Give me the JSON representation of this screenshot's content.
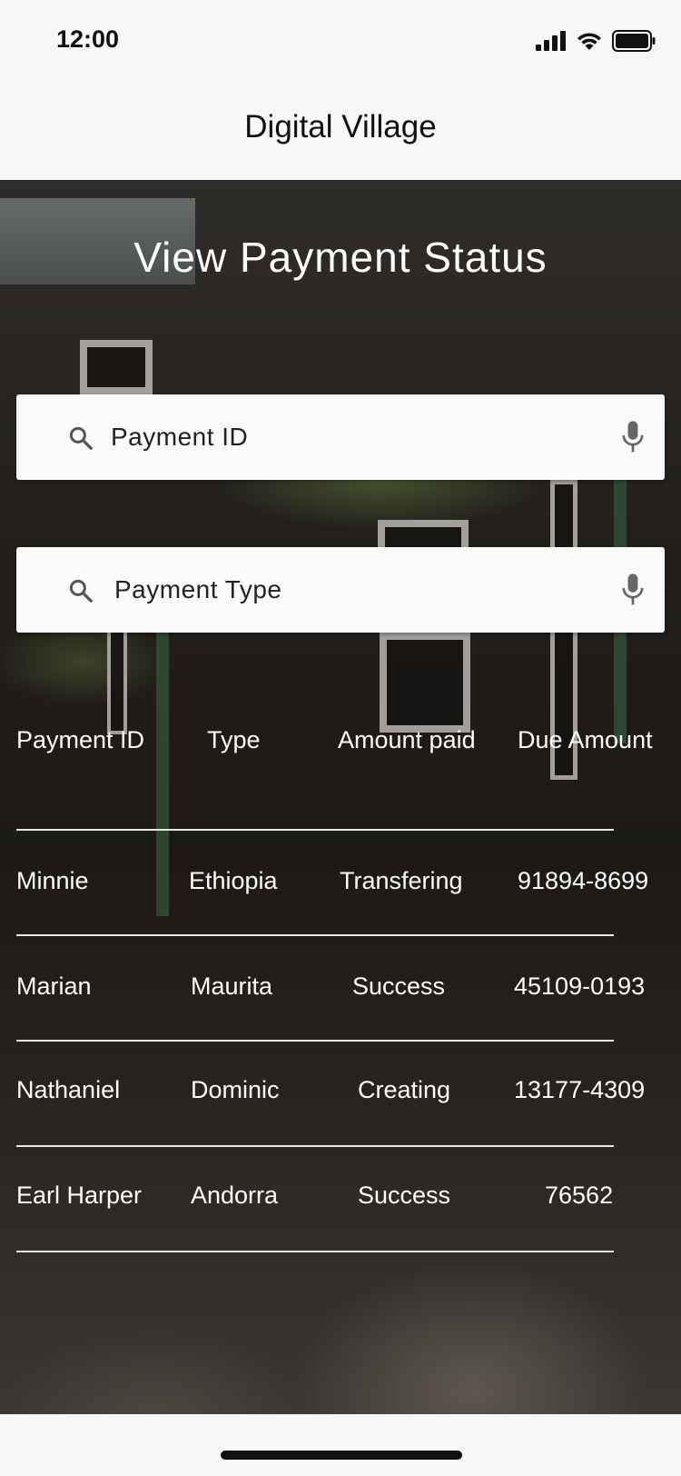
{
  "status_bar": {
    "time": "12:00"
  },
  "app_bar": {
    "title": "Digital Village"
  },
  "page": {
    "heading": "View Payment Status"
  },
  "search_payment_id": {
    "placeholder": "Payment ID"
  },
  "search_payment_type": {
    "placeholder": "Payment Type"
  },
  "table": {
    "headers": [
      "Payment ID",
      "Type",
      "Amount paid",
      "Due Amount"
    ],
    "rows": [
      [
        "Minnie",
        "Ethiopia",
        "Transfering",
        "91894-8699"
      ],
      [
        "Marian",
        "Maurita",
        "Success",
        "45109-0193"
      ],
      [
        "Nathaniel",
        "Dominic",
        "Creating",
        "13177-4309"
      ],
      [
        "Earl Harper",
        "Andorra",
        "Success",
        "76562"
      ]
    ]
  },
  "icons": {
    "search": "search-icon",
    "mic": "microphone-icon",
    "signal": "cellular-signal-icon",
    "wifi": "wifi-icon",
    "battery": "battery-icon"
  }
}
